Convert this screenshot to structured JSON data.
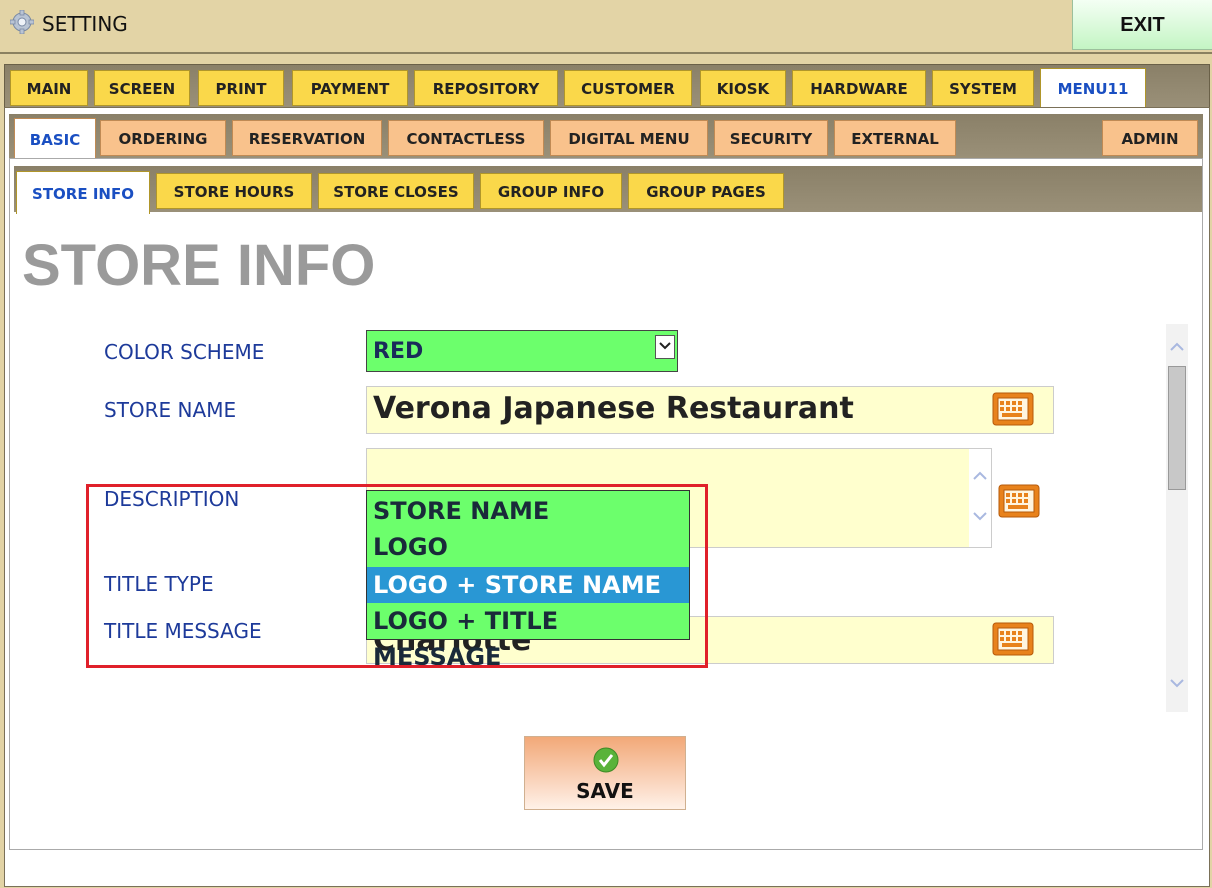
{
  "window": {
    "title": "SETTING",
    "exit_label": "EXIT"
  },
  "tabs_main": [
    "MAIN",
    "SCREEN",
    "PRINT",
    "PAYMENT",
    "REPOSITORY",
    "CUSTOMER",
    "KIOSK",
    "HARDWARE",
    "SYSTEM",
    "MENU11"
  ],
  "tabs_sub": [
    "BASIC",
    "ORDERING",
    "RESERVATION",
    "CONTACTLESS",
    "DIGITAL MENU",
    "SECURITY",
    "EXTERNAL",
    "ADMIN"
  ],
  "tabs_sub2": [
    "STORE INFO",
    "STORE HOURS",
    "STORE CLOSES",
    "GROUP INFO",
    "GROUP PAGES"
  ],
  "page": {
    "title": "STORE INFO"
  },
  "form": {
    "color_scheme": {
      "label": "COLOR SCHEME",
      "value": "RED"
    },
    "store_name": {
      "label": "STORE NAME",
      "value": "Verona Japanese Restaurant"
    },
    "description": {
      "label": "DESCRIPTION",
      "value": ""
    },
    "title_type": {
      "label": "TITLE TYPE"
    },
    "title_message": {
      "label": "TITLE MESSAGE",
      "value": "Charlotte"
    }
  },
  "dropdown": {
    "options": [
      "STORE NAME",
      "LOGO",
      "LOGO + STORE NAME",
      "LOGO + TITLE MESSAGE"
    ],
    "selected": "LOGO + STORE NAME"
  },
  "save_label": "SAVE",
  "colors": {
    "accent_green": "#6cff6c",
    "field_bg": "#ffffce",
    "tab_yellow": "#fad84a",
    "tab_orange": "#f9c28c",
    "selection_blue": "#2997d4",
    "highlight_red": "#e0202a"
  },
  "icons": [
    "gear-icon",
    "keyboard-icon",
    "checkmark-icon",
    "chevron-down-icon",
    "chevron-up-icon"
  ]
}
